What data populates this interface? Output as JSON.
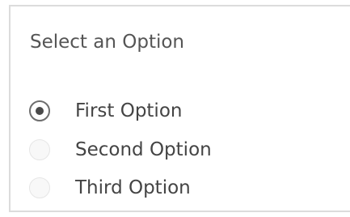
{
  "filter": {
    "title": "Select an Option",
    "selected_index": 0,
    "options": [
      {
        "label": "First Option",
        "checked": true
      },
      {
        "label": "Second Option",
        "checked": false
      },
      {
        "label": "Third Option",
        "checked": false
      }
    ]
  },
  "colors": {
    "border": "#dcdcdc",
    "text": "#444444",
    "title_text": "#555555",
    "radio_checked": "#4a4a4a",
    "radio_unchecked_border": "#e6e6e6"
  }
}
